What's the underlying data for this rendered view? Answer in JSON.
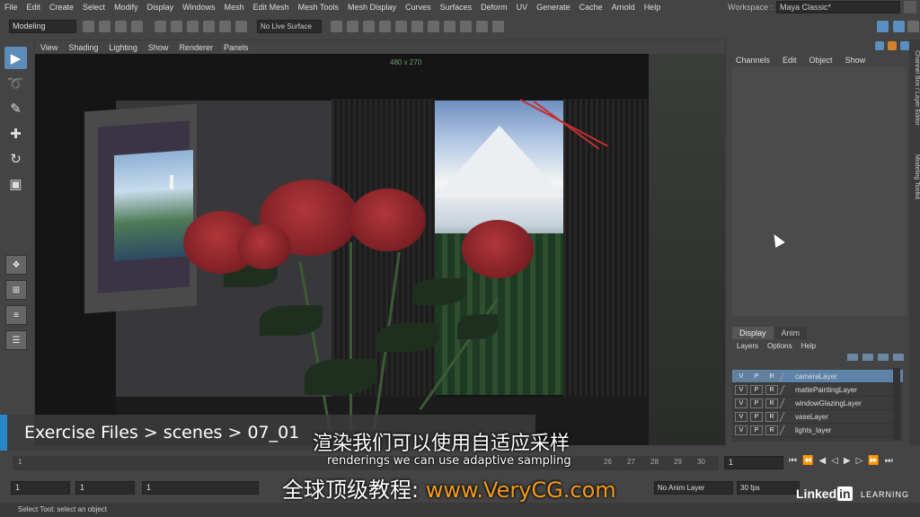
{
  "menubar": {
    "items": [
      "File",
      "Edit",
      "Create",
      "Select",
      "Modify",
      "Display",
      "Windows",
      "Mesh",
      "Edit Mesh",
      "Mesh Tools",
      "Mesh Display",
      "Curves",
      "Surfaces",
      "Deform",
      "UV",
      "Generate",
      "Cache",
      "Arnold",
      "Help"
    ],
    "workspace_label": "Workspace :",
    "workspace_value": "Maya Classic*"
  },
  "statusline": {
    "mode": "Modeling",
    "live_surface": "No Live Surface"
  },
  "viewport": {
    "menu": [
      "View",
      "Shading",
      "Lighting",
      "Show",
      "Renderer",
      "Panels"
    ],
    "resolution": "480 x 270"
  },
  "channel_box": {
    "menu": [
      "Channels",
      "Edit",
      "Object",
      "Show"
    ]
  },
  "layer_editor": {
    "tabs": [
      "Display",
      "Anim"
    ],
    "menu": [
      "Layers",
      "Options",
      "Help"
    ],
    "layers": [
      {
        "v": "V",
        "p": "P",
        "r": "R",
        "name": "cameraLayer",
        "selected": true
      },
      {
        "v": "V",
        "p": "P",
        "r": "R",
        "name": "mattePaintingLayer",
        "selected": false
      },
      {
        "v": "V",
        "p": "P",
        "r": "R",
        "name": "windowGlazingLayer",
        "selected": false
      },
      {
        "v": "V",
        "p": "P",
        "r": "R",
        "name": "vaseLayer",
        "selected": false
      },
      {
        "v": "V",
        "p": "P",
        "r": "R",
        "name": "lights_layer",
        "selected": false
      }
    ]
  },
  "side_tabs": {
    "channel_box": "Channel Box / Layer Editor",
    "modeling_toolkit": "Modeling Toolkit"
  },
  "timeslider": {
    "start_label": "1",
    "ticks": [
      "26",
      "27",
      "28",
      "29",
      "30"
    ],
    "current_frame": "1"
  },
  "rangeslider": {
    "start": "1",
    "range_start": "1",
    "range_inner": "1",
    "anim_layer": "No Anim Layer",
    "fps": "30 fps"
  },
  "help_line": "Select Tool: select an object",
  "overlay": {
    "breadcrumb": "Exercise Files > scenes > 07_01",
    "subtitle_cn": "渲染我们可以使用自适应采样",
    "subtitle_en": "renderings we can use adaptive sampling",
    "watermark_prefix": "全球顶级教程: ",
    "watermark_url": "www.VeryCG.com",
    "logo_text": "Linked",
    "logo_in": "in",
    "logo_learning": "LEARNING"
  },
  "icons": {
    "select_tool": "arrow-icon",
    "lasso_tool": "lasso-icon",
    "paint_tool": "paint-brush-icon",
    "move_tool": "move-icon",
    "rotate_tool": "rotate-icon",
    "scale_tool": "scale-icon"
  }
}
